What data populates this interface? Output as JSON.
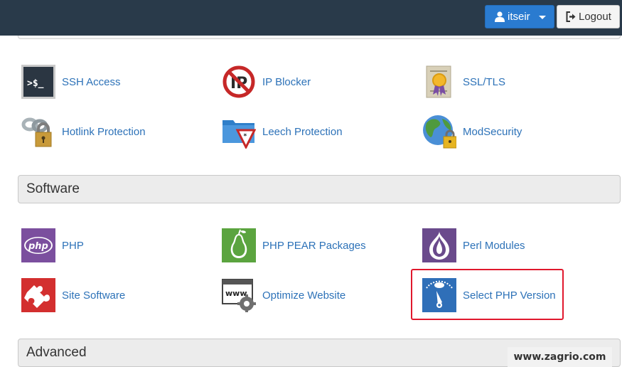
{
  "header": {
    "user_label": "itseir",
    "logout_label": "Logout",
    "background": "#293a4a",
    "user_button_color": "#2a7bd0"
  },
  "security": {
    "items": [
      {
        "label": "SSH Access",
        "icon": "terminal-icon"
      },
      {
        "label": "IP Blocker",
        "icon": "ip-blocker-icon"
      },
      {
        "label": "SSL/TLS",
        "icon": "certificate-icon"
      },
      {
        "label": "Hotlink Protection",
        "icon": "chain-lock-icon"
      },
      {
        "label": "Leech Protection",
        "icon": "folder-warning-icon"
      },
      {
        "label": "ModSecurity",
        "icon": "globe-lock-icon"
      }
    ]
  },
  "software": {
    "title": "Software",
    "items": [
      {
        "label": "PHP",
        "icon": "php-icon"
      },
      {
        "label": "PHP PEAR Packages",
        "icon": "pear-icon"
      },
      {
        "label": "Perl Modules",
        "icon": "onion-icon"
      },
      {
        "label": "Site Software",
        "icon": "puzzle-icon"
      },
      {
        "label": "Optimize Website",
        "icon": "www-gear-icon"
      },
      {
        "label": "Select PHP Version",
        "icon": "php-gauge-icon"
      }
    ]
  },
  "advanced": {
    "title": "Advanced"
  },
  "watermark": "www.zagrio.com",
  "colors": {
    "link": "#2d72b8",
    "highlight": "#e0182d"
  }
}
